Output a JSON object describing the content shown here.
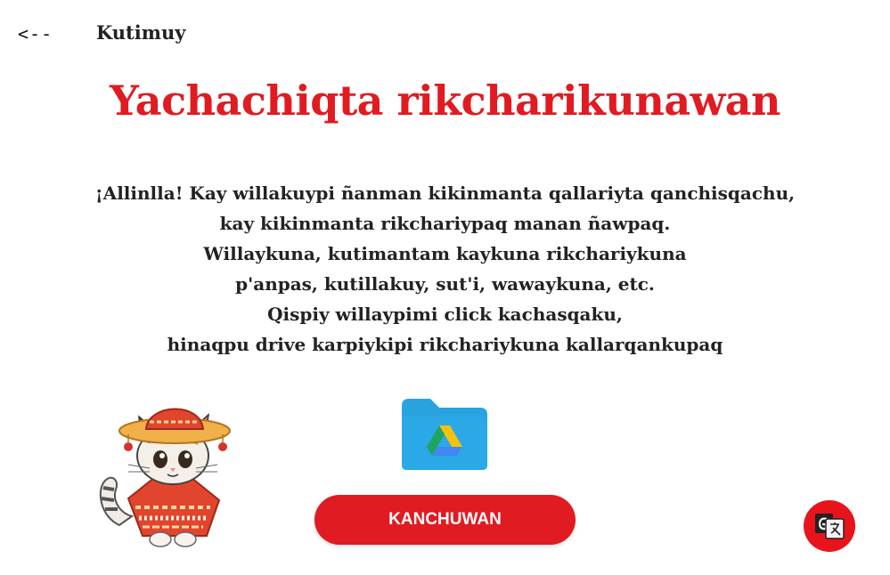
{
  "nav": {
    "back_arrow": "<--",
    "back_label": "Kutimuy"
  },
  "title": "Yachachiqta rikcharikunawan",
  "body_lines": [
    "¡Allinlla! Kay willakuypi ñanman kikinmanta qallariyta qanchisqachu,",
    "kay kikinmanta rikchariypaq manan ñawpaq.",
    "Willaykuna, kutimantam kaykuna rikchariykuna",
    "p'anpas, kutillakuy, sut'i, wawaykuna, etc.",
    "Qispiy willaypimi click kachasqaku,",
    "hinaqpu drive karpiykipi rikchariykuna kallarqankupaq"
  ],
  "download_button": {
    "label": "KANCHUWAN"
  },
  "icons": {
    "cat": "cat-illustration",
    "folder": "drive-folder-icon",
    "translate": "translate-icon"
  },
  "colors": {
    "accent": "#e01b22",
    "folder": "#29a3df",
    "text": "#222222"
  }
}
